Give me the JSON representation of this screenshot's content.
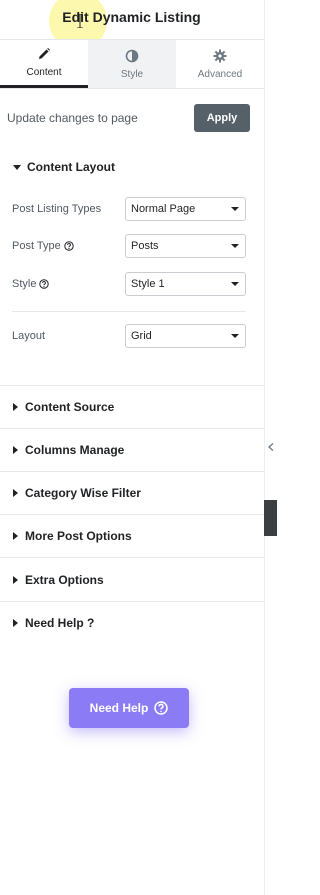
{
  "header": {
    "title": "Edit Dynamic Listing"
  },
  "tabs": [
    {
      "label": "Content",
      "icon": "pencil-icon",
      "active": true
    },
    {
      "label": "Style",
      "icon": "contrast-icon",
      "active": false
    },
    {
      "label": "Advanced",
      "icon": "gear-icon",
      "active": false
    }
  ],
  "update": {
    "text": "Update changes to page",
    "apply_label": "Apply"
  },
  "content_layout": {
    "heading": "Content Layout",
    "fields": [
      {
        "label": "Post Listing Types",
        "value": "Normal Page",
        "help": false
      },
      {
        "label": "Post Type",
        "value": "Posts",
        "help": true
      },
      {
        "label": "Style",
        "value": "Style 1",
        "help": true
      },
      {
        "label": "Layout",
        "value": "Grid",
        "help": false
      }
    ]
  },
  "sections": [
    {
      "label": "Content Source"
    },
    {
      "label": "Columns Manage"
    },
    {
      "label": "Category Wise Filter"
    },
    {
      "label": "More Post Options"
    },
    {
      "label": "Extra Options"
    },
    {
      "label": "Need Help ?"
    }
  ],
  "need_help_button": {
    "label": "Need Help",
    "icon": "question-circle-icon"
  },
  "colors": {
    "accent": "#8b7cf6",
    "apply": "#556068",
    "text": "#1f2124"
  }
}
